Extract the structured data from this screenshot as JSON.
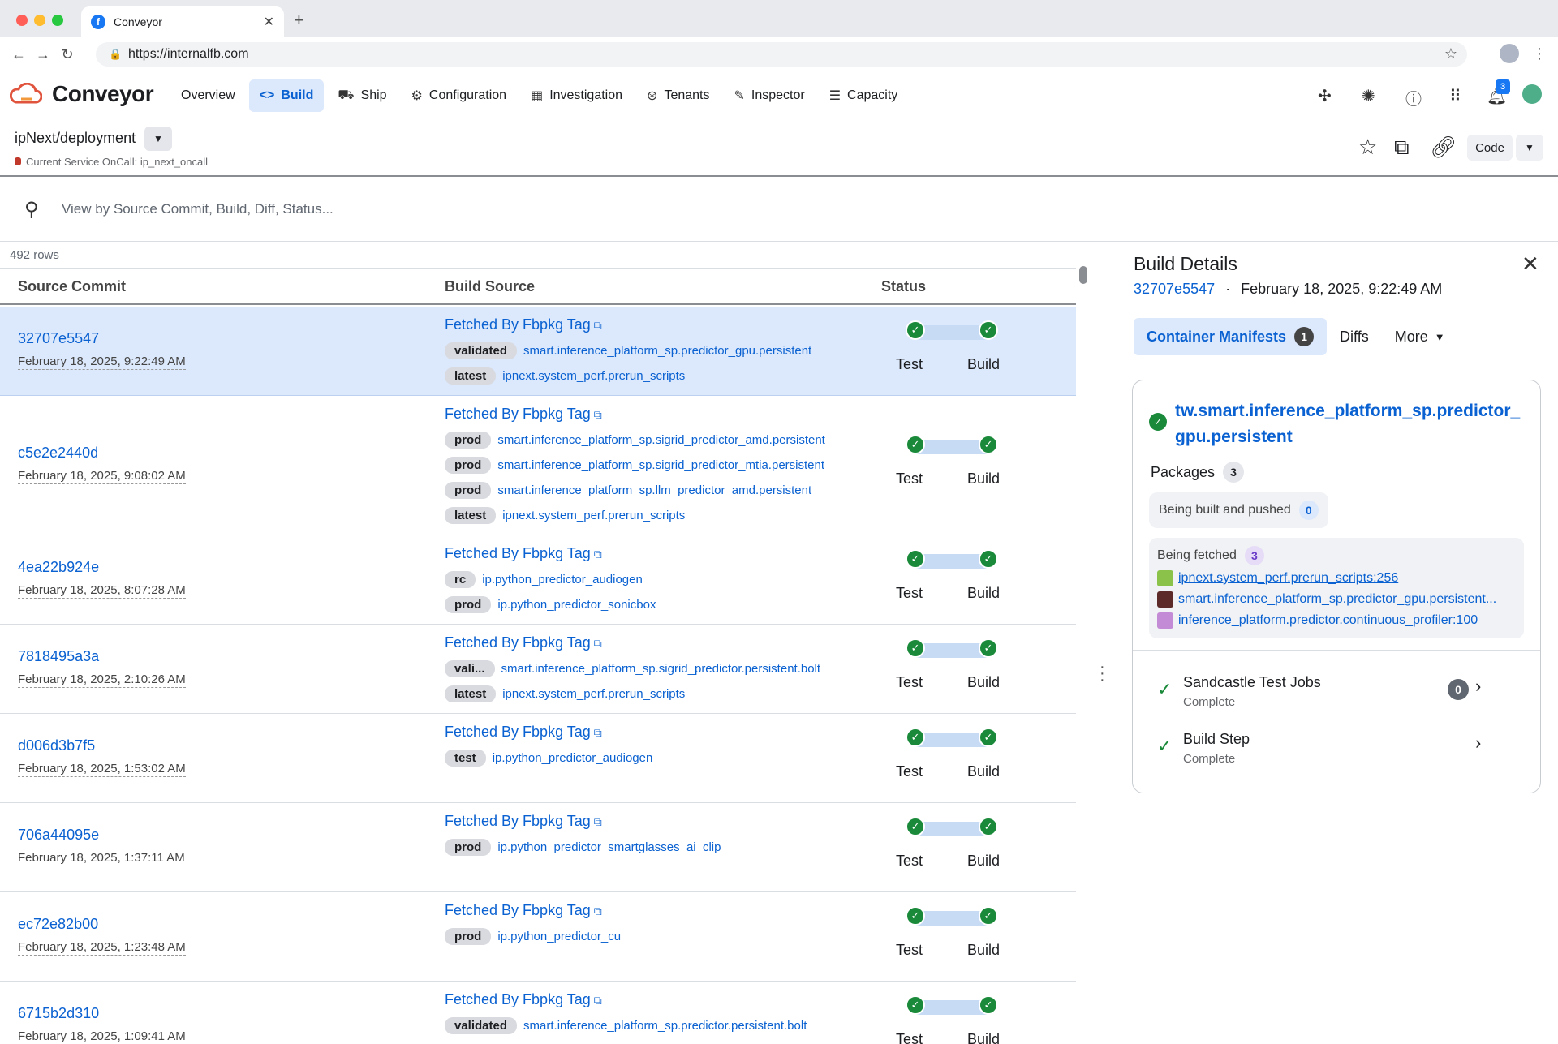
{
  "browser": {
    "tab_title": "Conveyor",
    "url": "https://internalfb.com"
  },
  "app": {
    "name": "Conveyor",
    "nav": [
      {
        "label": "Overview",
        "icon": ""
      },
      {
        "label": "Build",
        "icon": "code-icon",
        "active": true
      },
      {
        "label": "Ship",
        "icon": "truck-icon"
      },
      {
        "label": "Configuration",
        "icon": "gear-icon"
      },
      {
        "label": "Investigation",
        "icon": "grid-icon"
      },
      {
        "label": "Tenants",
        "icon": "tenants-icon"
      },
      {
        "label": "Inspector",
        "icon": "leaf-icon"
      },
      {
        "label": "Capacity",
        "icon": "server-icon"
      }
    ],
    "notification_count": "3"
  },
  "service": {
    "name": "ipNext/deployment",
    "oncall": "Current Service OnCall: ip_next_oncall",
    "code_label": "Code"
  },
  "search": {
    "placeholder": "View by Source Commit, Build, Diff, Status..."
  },
  "table": {
    "row_count": "492 rows",
    "columns": [
      "Source Commit",
      "Build Source",
      "Status"
    ],
    "fetch_label": "Fetched By Fbpkg Tag",
    "status_labels": [
      "Test",
      "Build"
    ],
    "rows": [
      {
        "commit": "32707e5547",
        "date": "February 18, 2025, 9:22:49 AM",
        "packages": [
          {
            "tag": "validated",
            "name": "smart.inference_platform_sp.predictor_gpu.persistent"
          },
          {
            "tag": "latest",
            "name": "ipnext.system_perf.prerun_scripts"
          }
        ]
      },
      {
        "commit": "c5e2e2440d",
        "date": "February 18, 2025, 9:08:02 AM",
        "packages": [
          {
            "tag": "prod",
            "name": "smart.inference_platform_sp.sigrid_predictor_amd.persistent"
          },
          {
            "tag": "prod",
            "name": "smart.inference_platform_sp.sigrid_predictor_mtia.persistent"
          },
          {
            "tag": "prod",
            "name": "smart.inference_platform_sp.llm_predictor_amd.persistent"
          },
          {
            "tag": "latest",
            "name": "ipnext.system_perf.prerun_scripts"
          }
        ]
      },
      {
        "commit": "4ea22b924e",
        "date": "February 18, 2025, 8:07:28 AM",
        "packages": [
          {
            "tag": "rc",
            "name": "ip.python_predictor_audiogen"
          },
          {
            "tag": "prod",
            "name": "ip.python_predictor_sonicbox"
          }
        ]
      },
      {
        "commit": "7818495a3a",
        "date": "February 18, 2025, 2:10:26 AM",
        "packages": [
          {
            "tag": "vali...",
            "name": "smart.inference_platform_sp.sigrid_predictor.persistent.bolt"
          },
          {
            "tag": "latest",
            "name": "ipnext.system_perf.prerun_scripts"
          }
        ]
      },
      {
        "commit": "d006d3b7f5",
        "date": "February 18, 2025, 1:53:02 AM",
        "packages": [
          {
            "tag": "test",
            "name": "ip.python_predictor_audiogen"
          }
        ]
      },
      {
        "commit": "706a44095e",
        "date": "February 18, 2025, 1:37:11 AM",
        "packages": [
          {
            "tag": "prod",
            "name": "ip.python_predictor_smartglasses_ai_clip"
          }
        ]
      },
      {
        "commit": "ec72e82b00",
        "date": "February 18, 2025, 1:23:48 AM",
        "packages": [
          {
            "tag": "prod",
            "name": "ip.python_predictor_cu"
          }
        ]
      },
      {
        "commit": "6715b2d310",
        "date": "February 18, 2025, 1:09:41 AM",
        "packages": [
          {
            "tag": "validated",
            "name": "smart.inference_platform_sp.predictor.persistent.bolt"
          }
        ]
      }
    ]
  },
  "details": {
    "title": "Build Details",
    "commit": "32707e5547",
    "separator": "·",
    "date": "February 18, 2025, 9:22:49 AM",
    "tabs": [
      {
        "label": "Container Manifests",
        "count": "1"
      },
      {
        "label": "Diffs"
      },
      {
        "label": "More"
      }
    ],
    "manifest_title": "tw.smart.inference_platform_sp.predictor_gpu.persistent",
    "packages_label": "Packages",
    "packages_count": "3",
    "built_label": "Being built and pushed",
    "built_count": "0",
    "fetched_label": "Being fetched",
    "fetched_count": "3",
    "fetched": [
      {
        "name": "ipnext.system_perf.prerun_scripts:256",
        "color": "#8bc34a"
      },
      {
        "name": "smart.inference_platform_sp.predictor_gpu.persistent...",
        "color": "#5d2a2a"
      },
      {
        "name": "inference_platform.predictor.continuous_profiler:100",
        "color": "#c38bd6"
      }
    ],
    "jobs": [
      {
        "title": "Sandcastle Test Jobs",
        "status": "Complete",
        "count": "0"
      },
      {
        "title": "Build Step",
        "status": "Complete"
      }
    ]
  }
}
